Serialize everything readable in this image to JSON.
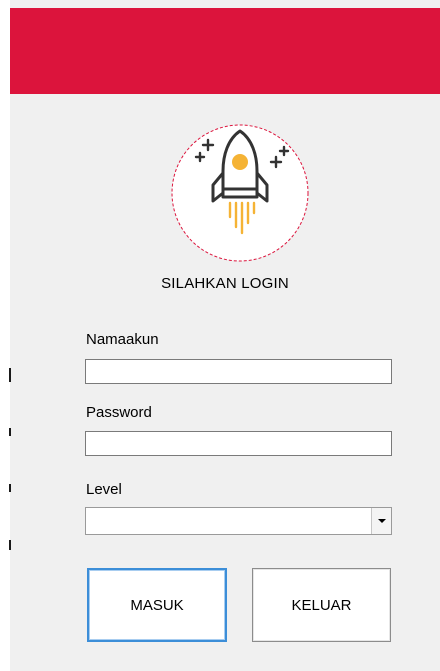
{
  "colors": {
    "header": "#dc143c",
    "window_bg": "#f0f0f0",
    "logo_circle_border": "#dc143c",
    "rocket_flame": "#f5b335",
    "rocket_outline": "#333333",
    "primary_button_border": "#3c8ed8"
  },
  "logo": {
    "icon": "rocket-icon"
  },
  "form": {
    "title": "SILAHKAN LOGIN",
    "username_label": "Namaakun",
    "username_value": "",
    "password_label": "Password",
    "password_value": "",
    "level_label": "Level",
    "level_value": ""
  },
  "buttons": {
    "login_label": "MASUK",
    "exit_label": "KELUAR"
  }
}
